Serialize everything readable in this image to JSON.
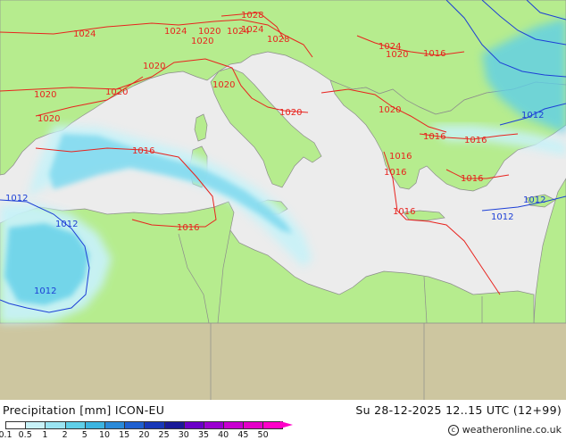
{
  "map": {
    "colors": {
      "sea": "#ececec",
      "land": "#b6ec8e",
      "outside_domain": "#cdc6a0",
      "border": "#8c8c8c",
      "isobar_high": "#e8231e",
      "isobar_low": "#1d3fd6"
    },
    "isobar_labels": [
      {
        "text": "1024",
        "color": "red"
      },
      {
        "text": "1028",
        "color": "red"
      },
      {
        "text": "1024",
        "color": "red"
      },
      {
        "text": "1020",
        "color": "red"
      },
      {
        "text": "1024",
        "color": "red"
      },
      {
        "text": "1020",
        "color": "red"
      },
      {
        "text": "1028",
        "color": "red"
      },
      {
        "text": "1024",
        "color": "red"
      },
      {
        "text": "1020",
        "color": "red"
      },
      {
        "text": "1016",
        "color": "red"
      },
      {
        "text": "1020",
        "color": "red"
      },
      {
        "text": "1020",
        "color": "red"
      },
      {
        "text": "1020",
        "color": "red"
      },
      {
        "text": "1020",
        "color": "red"
      },
      {
        "text": "1024",
        "color": "red"
      },
      {
        "text": "1020",
        "color": "red"
      },
      {
        "text": "1020",
        "color": "red"
      },
      {
        "text": "1020",
        "color": "red"
      },
      {
        "text": "1016",
        "color": "red"
      },
      {
        "text": "1016",
        "color": "red"
      },
      {
        "text": "1016",
        "color": "red"
      },
      {
        "text": "1016",
        "color": "red"
      },
      {
        "text": "1016",
        "color": "red"
      },
      {
        "text": "1016",
        "color": "red"
      },
      {
        "text": "1016",
        "color": "red"
      },
      {
        "text": "1016",
        "color": "red"
      },
      {
        "text": "1012",
        "color": "blue"
      },
      {
        "text": "1012",
        "color": "blue"
      },
      {
        "text": "1012",
        "color": "blue"
      },
      {
        "text": "1012",
        "color": "blue"
      },
      {
        "text": "1012",
        "color": "blue"
      },
      {
        "text": "1012",
        "color": "blue"
      }
    ]
  },
  "footer": {
    "title": "Precipitation [mm] ICON-EU",
    "valid_time": "Su 28-12-2025 12..15 UTC (12+99)",
    "copyright": "weatheronline.co.uk",
    "copyright_icon": "copyright-icon"
  },
  "legend": {
    "labels": [
      "0.1",
      "0.5",
      "1",
      "2",
      "5",
      "10",
      "15",
      "20",
      "25",
      "30",
      "35",
      "40",
      "45",
      "50"
    ],
    "colors": [
      "#ffffff",
      "#c8f2f8",
      "#9ae4f2",
      "#5fcfe8",
      "#3cb4e0",
      "#2a8ad8",
      "#1f60d0",
      "#1838b8",
      "#1a1a98",
      "#6a00c8",
      "#9a00d0",
      "#c800d0",
      "#e400c8",
      "#ff00c8"
    ]
  }
}
